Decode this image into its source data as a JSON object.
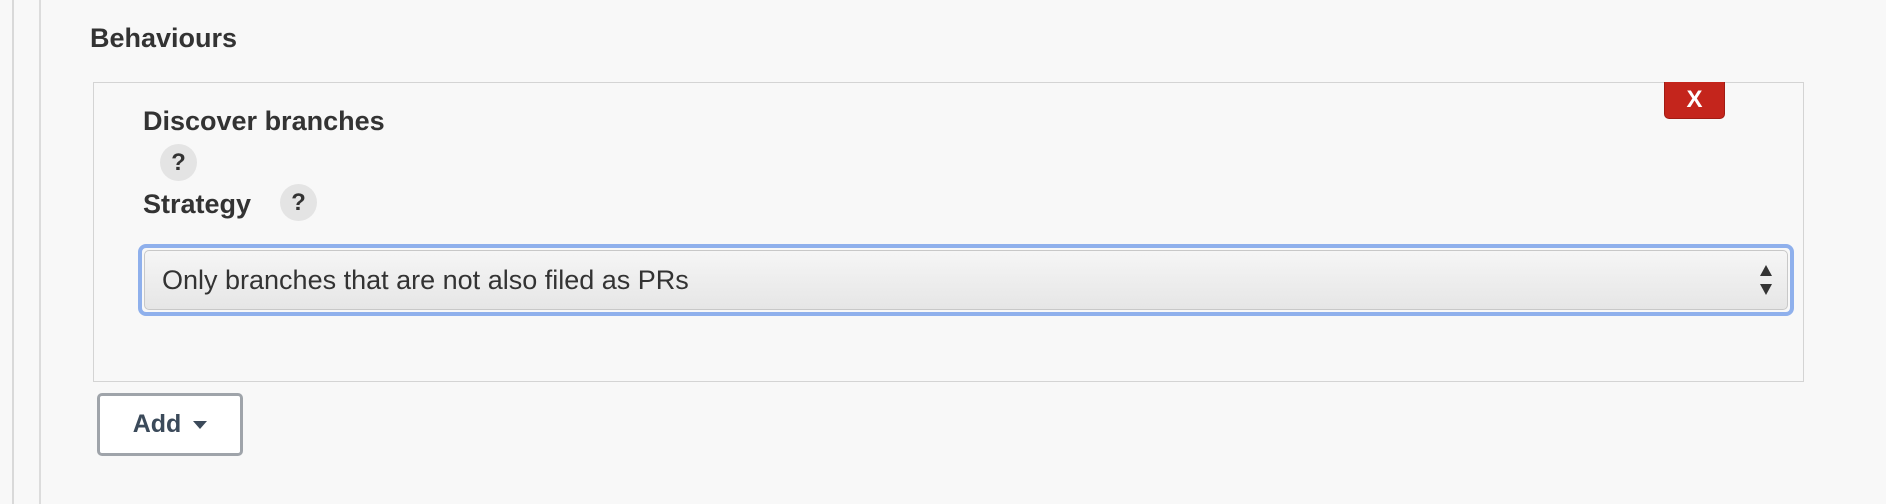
{
  "section": {
    "title": "Behaviours"
  },
  "behaviour": {
    "title": "Discover branches",
    "delete_label": "X",
    "help_symbol": "?",
    "strategy_label": "Strategy",
    "strategy_selected": "Only branches that are not also filed as PRs",
    "delete_color": "#c4251c",
    "focus_color": "#8fb0ec"
  },
  "add_button": {
    "label": "Add",
    "icon": "caret-down-icon"
  }
}
